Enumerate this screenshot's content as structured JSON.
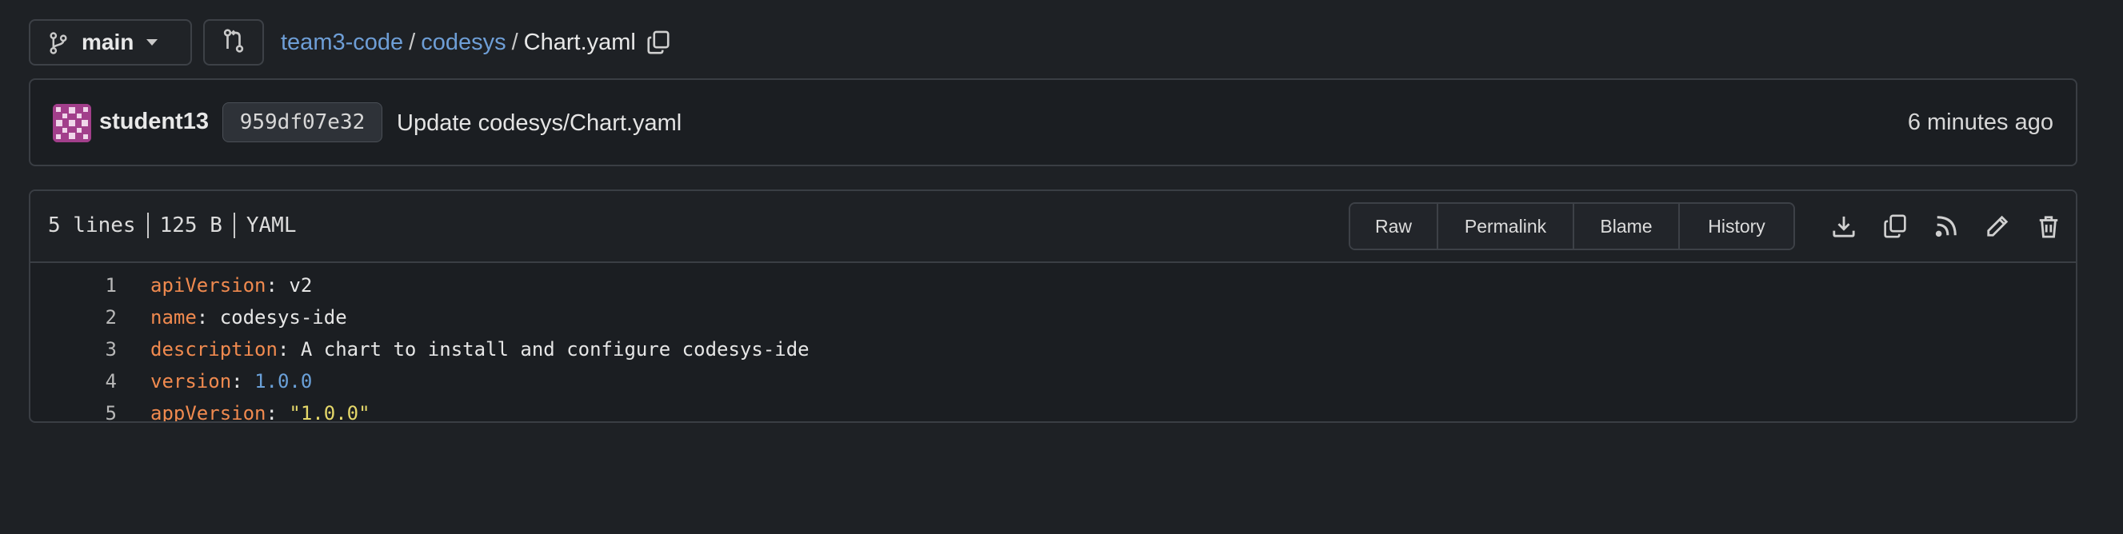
{
  "branch": {
    "name": "main"
  },
  "breadcrumb": {
    "repo": "team3-code",
    "folder": "codesys",
    "sep1": "/",
    "sep2": "/",
    "file": "Chart.yaml"
  },
  "commit": {
    "author": "student13",
    "sha": "959df07e32",
    "message": "Update codesys/Chart.yaml",
    "time": "6 minutes ago"
  },
  "file": {
    "lines": "5 lines",
    "size": "125 B",
    "language": "YAML",
    "buttons": {
      "raw": "Raw",
      "permalink": "Permalink",
      "blame": "Blame",
      "history": "History"
    }
  },
  "code": [
    {
      "num": "1",
      "key": "apiVersion",
      "sep": ": ",
      "value": "v2",
      "type": "plain"
    },
    {
      "num": "2",
      "key": "name",
      "sep": ": ",
      "value": "codesys-ide",
      "type": "plain"
    },
    {
      "num": "3",
      "key": "description",
      "sep": ": ",
      "value": "A chart to install and configure codesys-ide",
      "type": "plain"
    },
    {
      "num": "4",
      "key": "version",
      "sep": ": ",
      "value": "1.0.0",
      "type": "number"
    },
    {
      "num": "5",
      "key": "appVersion",
      "sep": ": ",
      "value": "\"1.0.0\"",
      "type": "string"
    }
  ],
  "colors": {
    "link": "#6e9ed6",
    "yaml_key": "#f08a4f",
    "yaml_number": "#6aa0d8",
    "yaml_string": "#e5d86a",
    "avatar": "#a23f8b"
  },
  "icons": [
    "git-branch-icon",
    "git-compare-icon",
    "copy-icon",
    "download-icon",
    "copy-icon",
    "rss-icon",
    "pencil-icon",
    "trash-icon"
  ]
}
